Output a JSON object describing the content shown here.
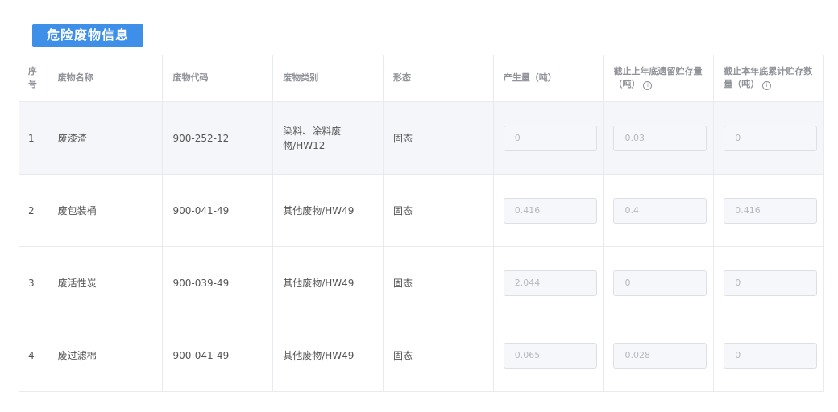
{
  "section": {
    "title": "危险废物信息"
  },
  "table": {
    "headers": {
      "index": "序号",
      "name": "废物名称",
      "code": "废物代码",
      "category": "废物类别",
      "form": "形态",
      "produced": "产生量（吨）",
      "last_year_storage": "截止上年底遗留贮存量（吨）",
      "this_year_storage": "截止本年底累计贮存数量（吨）"
    },
    "rows": [
      {
        "index": "1",
        "name": "废漆渣",
        "code": "900-252-12",
        "category": "染料、涂料废物/HW12",
        "form": "固态",
        "produced": "0",
        "last_year_storage": "0.03",
        "this_year_storage": "0"
      },
      {
        "index": "2",
        "name": "废包装桶",
        "code": "900-041-49",
        "category": "其他废物/HW49",
        "form": "固态",
        "produced": "0.416",
        "last_year_storage": "0.4",
        "this_year_storage": "0.416"
      },
      {
        "index": "3",
        "name": "废活性炭",
        "code": "900-039-49",
        "category": "其他废物/HW49",
        "form": "固态",
        "produced": "2.044",
        "last_year_storage": "0",
        "this_year_storage": "0"
      },
      {
        "index": "4",
        "name": "废过滤棉",
        "code": "900-041-49",
        "category": "其他废物/HW49",
        "form": "固态",
        "produced": "0.065",
        "last_year_storage": "0.028",
        "this_year_storage": "0"
      }
    ]
  },
  "icons": {
    "info": "info-circle-icon"
  },
  "colors": {
    "title_bg": "#3d8fe8",
    "stripe": "#f5f6f9",
    "border": "#e8eaee"
  }
}
